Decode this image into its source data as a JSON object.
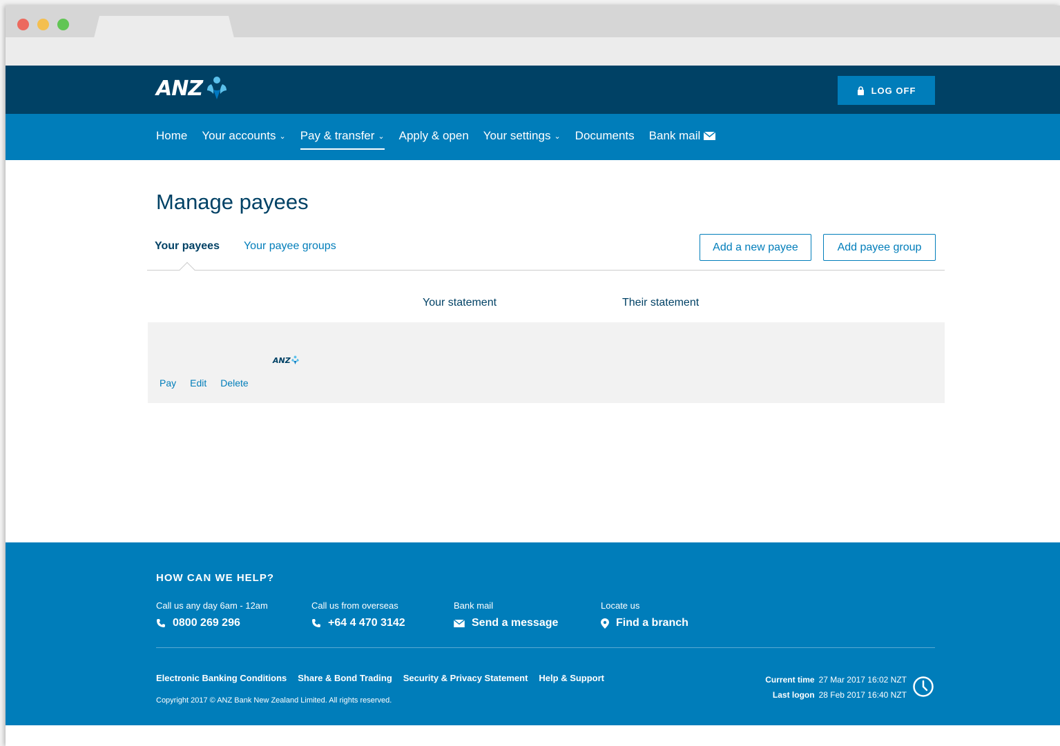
{
  "brand": {
    "name": "ANZ"
  },
  "header": {
    "logoff_label": "LOG OFF"
  },
  "nav": {
    "items": [
      {
        "label": "Home",
        "dropdown": false,
        "active": false
      },
      {
        "label": "Your accounts",
        "dropdown": true,
        "active": false
      },
      {
        "label": "Pay & transfer",
        "dropdown": true,
        "active": true
      },
      {
        "label": "Apply & open",
        "dropdown": false,
        "active": false
      },
      {
        "label": "Your settings",
        "dropdown": true,
        "active": false
      },
      {
        "label": "Documents",
        "dropdown": false,
        "active": false
      },
      {
        "label": "Bank mail",
        "dropdown": false,
        "active": false
      }
    ]
  },
  "main": {
    "title": "Manage payees",
    "tabs": [
      {
        "label": "Your payees",
        "active": true
      },
      {
        "label": "Your payee groups",
        "active": false
      }
    ],
    "add_payee_label": "Add a new payee",
    "add_group_label": "Add payee group",
    "columns": {
      "your_statement": "Your statement",
      "their_statement": "Their statement"
    },
    "payee_row": {
      "bank_logo": "ANZ",
      "actions": [
        "Pay",
        "Edit",
        "Delete"
      ]
    }
  },
  "footer": {
    "help_title": "HOW CAN WE HELP?",
    "contacts": [
      {
        "label": "Call us any day 6am - 12am",
        "value": "0800 269 296",
        "icon": "phone-icon"
      },
      {
        "label": "Call us from overseas",
        "value": "+64 4 470 3142",
        "icon": "phone-icon"
      },
      {
        "label": "Bank mail",
        "value": "Send a message",
        "icon": "mail-icon"
      },
      {
        "label": "Locate us",
        "value": "Find a branch",
        "icon": "location-icon"
      }
    ],
    "links": [
      "Electronic Banking Conditions",
      "Share & Bond Trading",
      "Security & Privacy Statement",
      "Help & Support"
    ],
    "copyright": "Copyright 2017 © ANZ Bank New Zealand Limited. All rights reserved.",
    "current_time_label": "Current time",
    "current_time": "27 Mar 2017 16:02 NZT",
    "last_logon_label": "Last logon",
    "last_logon": "28 Feb 2017 16:40 NZT"
  },
  "colors": {
    "dark_blue": "#004165",
    "brand_blue": "#007dba"
  }
}
